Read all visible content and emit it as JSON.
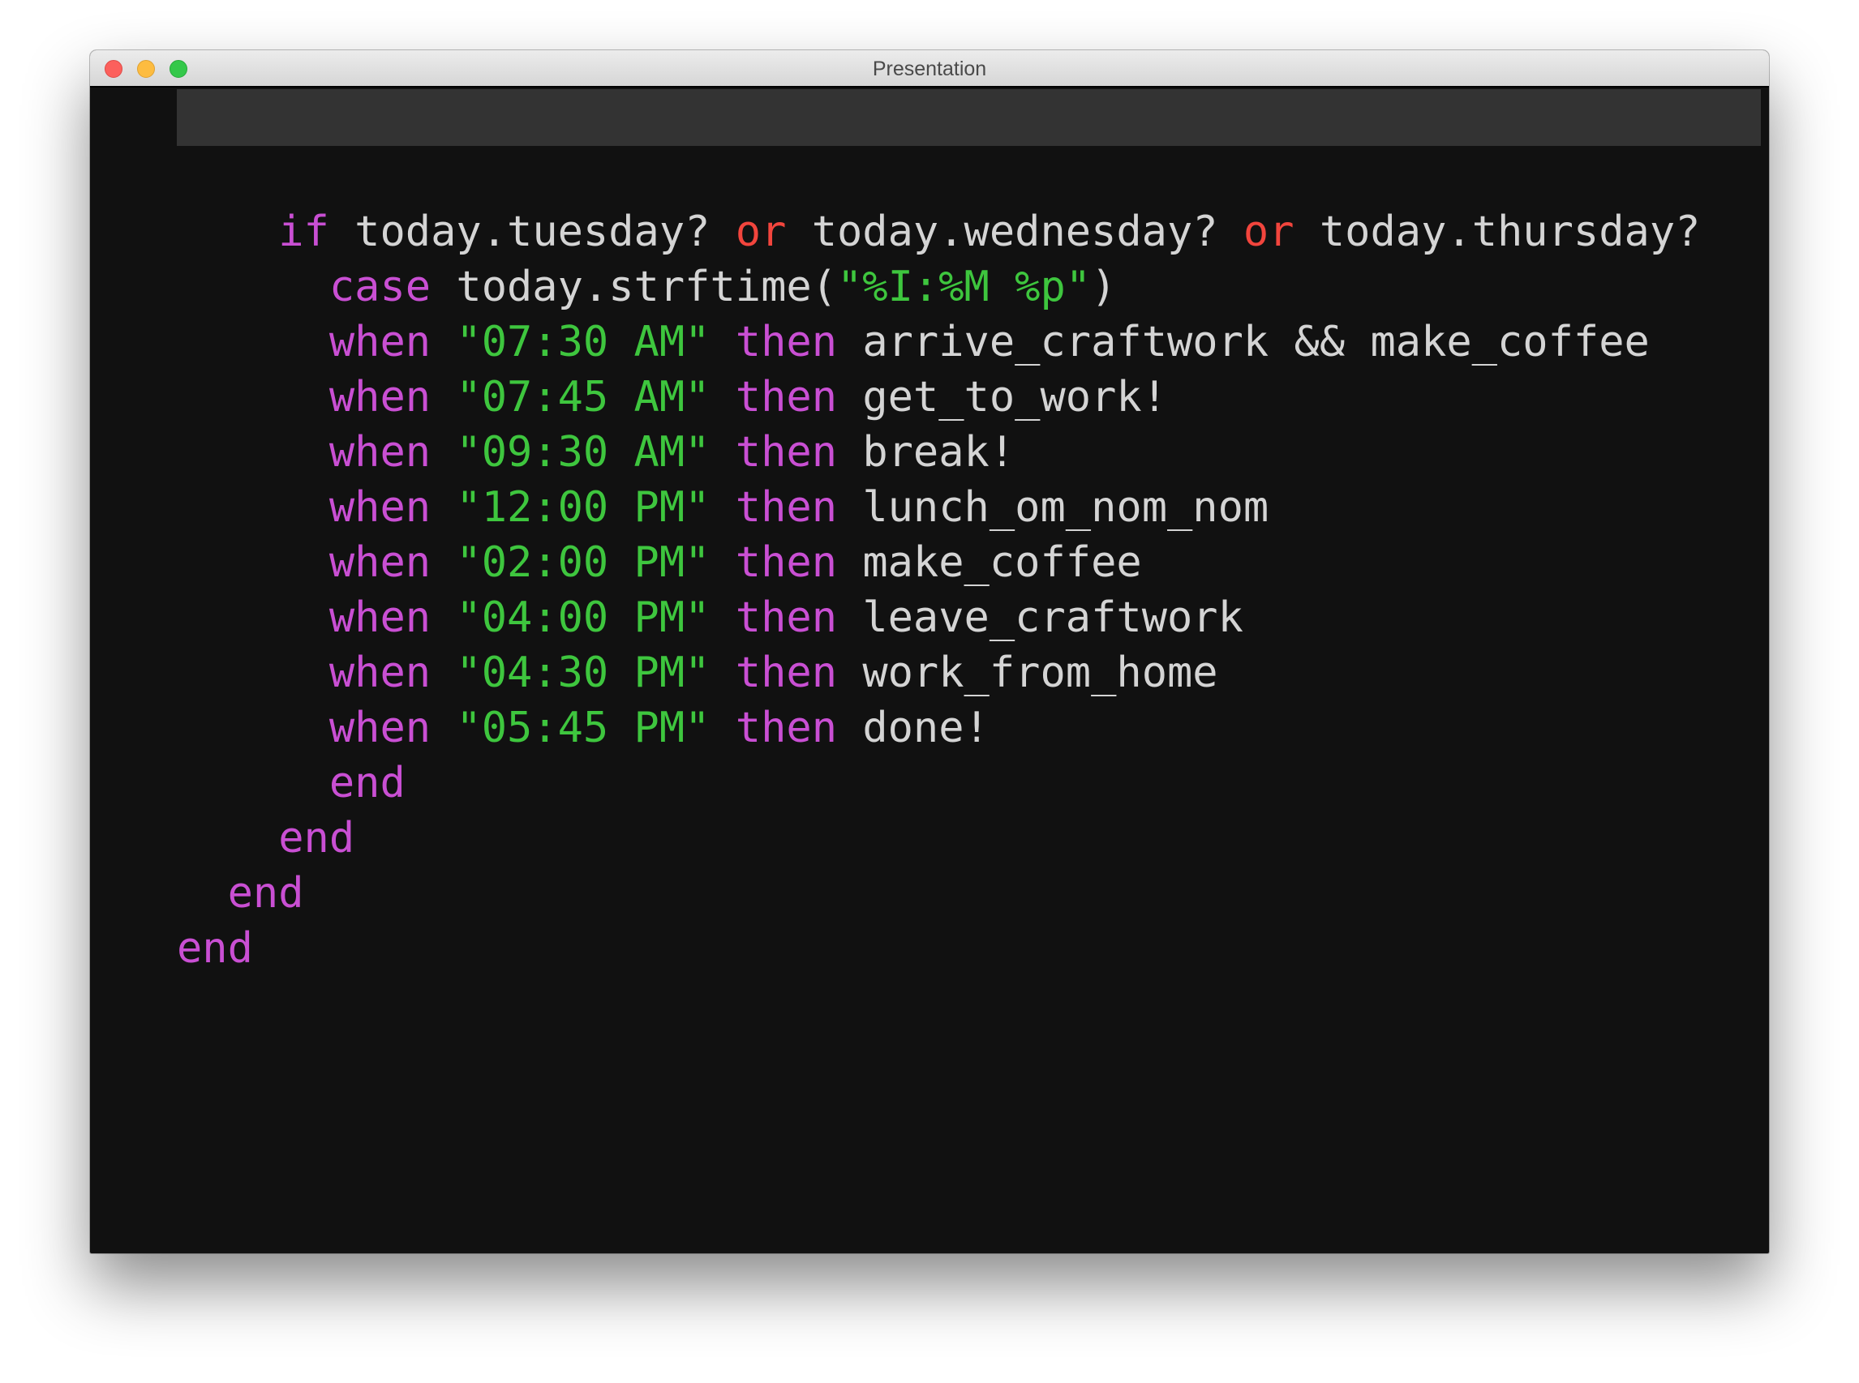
{
  "window": {
    "title": "Presentation"
  },
  "colors": {
    "keyword": "#c94fd3",
    "operator": "#f2453d",
    "string": "#3ec63e",
    "identifier": "#d4d4d4",
    "background": "#111111",
    "top_bar": "#333333"
  },
  "code": {
    "lines": [
      [
        {
          "t": "    ",
          "c": "id"
        },
        {
          "t": "if",
          "c": "kw"
        },
        {
          "t": " today.tuesday? ",
          "c": "id"
        },
        {
          "t": "or",
          "c": "op"
        },
        {
          "t": " today.wednesday? ",
          "c": "id"
        },
        {
          "t": "or",
          "c": "op"
        },
        {
          "t": " today.thursday?",
          "c": "id"
        }
      ],
      [
        {
          "t": "      ",
          "c": "id"
        },
        {
          "t": "case",
          "c": "kw"
        },
        {
          "t": " today.strftime(",
          "c": "id"
        },
        {
          "t": "\"%I:%M %p\"",
          "c": "str"
        },
        {
          "t": ")",
          "c": "id"
        }
      ],
      [
        {
          "t": "      ",
          "c": "id"
        },
        {
          "t": "when",
          "c": "kw"
        },
        {
          "t": " ",
          "c": "id"
        },
        {
          "t": "\"07:30 AM\"",
          "c": "str"
        },
        {
          "t": " ",
          "c": "id"
        },
        {
          "t": "then",
          "c": "kw"
        },
        {
          "t": " arrive_craftwork && make_coffee",
          "c": "id"
        }
      ],
      [
        {
          "t": "      ",
          "c": "id"
        },
        {
          "t": "when",
          "c": "kw"
        },
        {
          "t": " ",
          "c": "id"
        },
        {
          "t": "\"07:45 AM\"",
          "c": "str"
        },
        {
          "t": " ",
          "c": "id"
        },
        {
          "t": "then",
          "c": "kw"
        },
        {
          "t": " get_to_work!",
          "c": "id"
        }
      ],
      [
        {
          "t": "      ",
          "c": "id"
        },
        {
          "t": "when",
          "c": "kw"
        },
        {
          "t": " ",
          "c": "id"
        },
        {
          "t": "\"09:30 AM\"",
          "c": "str"
        },
        {
          "t": " ",
          "c": "id"
        },
        {
          "t": "then",
          "c": "kw"
        },
        {
          "t": " break!",
          "c": "id"
        }
      ],
      [
        {
          "t": "      ",
          "c": "id"
        },
        {
          "t": "when",
          "c": "kw"
        },
        {
          "t": " ",
          "c": "id"
        },
        {
          "t": "\"12:00 PM\"",
          "c": "str"
        },
        {
          "t": " ",
          "c": "id"
        },
        {
          "t": "then",
          "c": "kw"
        },
        {
          "t": " lunch_om_nom_nom",
          "c": "id"
        }
      ],
      [
        {
          "t": "      ",
          "c": "id"
        },
        {
          "t": "when",
          "c": "kw"
        },
        {
          "t": " ",
          "c": "id"
        },
        {
          "t": "\"02:00 PM\"",
          "c": "str"
        },
        {
          "t": " ",
          "c": "id"
        },
        {
          "t": "then",
          "c": "kw"
        },
        {
          "t": " make_coffee",
          "c": "id"
        }
      ],
      [
        {
          "t": "      ",
          "c": "id"
        },
        {
          "t": "when",
          "c": "kw"
        },
        {
          "t": " ",
          "c": "id"
        },
        {
          "t": "\"04:00 PM\"",
          "c": "str"
        },
        {
          "t": " ",
          "c": "id"
        },
        {
          "t": "then",
          "c": "kw"
        },
        {
          "t": " leave_craftwork",
          "c": "id"
        }
      ],
      [
        {
          "t": "      ",
          "c": "id"
        },
        {
          "t": "when",
          "c": "kw"
        },
        {
          "t": " ",
          "c": "id"
        },
        {
          "t": "\"04:30 PM\"",
          "c": "str"
        },
        {
          "t": " ",
          "c": "id"
        },
        {
          "t": "then",
          "c": "kw"
        },
        {
          "t": " work_from_home",
          "c": "id"
        }
      ],
      [
        {
          "t": "      ",
          "c": "id"
        },
        {
          "t": "when",
          "c": "kw"
        },
        {
          "t": " ",
          "c": "id"
        },
        {
          "t": "\"05:45 PM\"",
          "c": "str"
        },
        {
          "t": " ",
          "c": "id"
        },
        {
          "t": "then",
          "c": "kw"
        },
        {
          "t": " done!",
          "c": "id"
        }
      ],
      [
        {
          "t": "      ",
          "c": "id"
        },
        {
          "t": "end",
          "c": "kw"
        }
      ],
      [
        {
          "t": "    ",
          "c": "id"
        },
        {
          "t": "end",
          "c": "kw"
        }
      ],
      [
        {
          "t": "  ",
          "c": "id"
        },
        {
          "t": "end",
          "c": "kw"
        }
      ],
      [
        {
          "t": "end",
          "c": "kw"
        }
      ]
    ]
  }
}
